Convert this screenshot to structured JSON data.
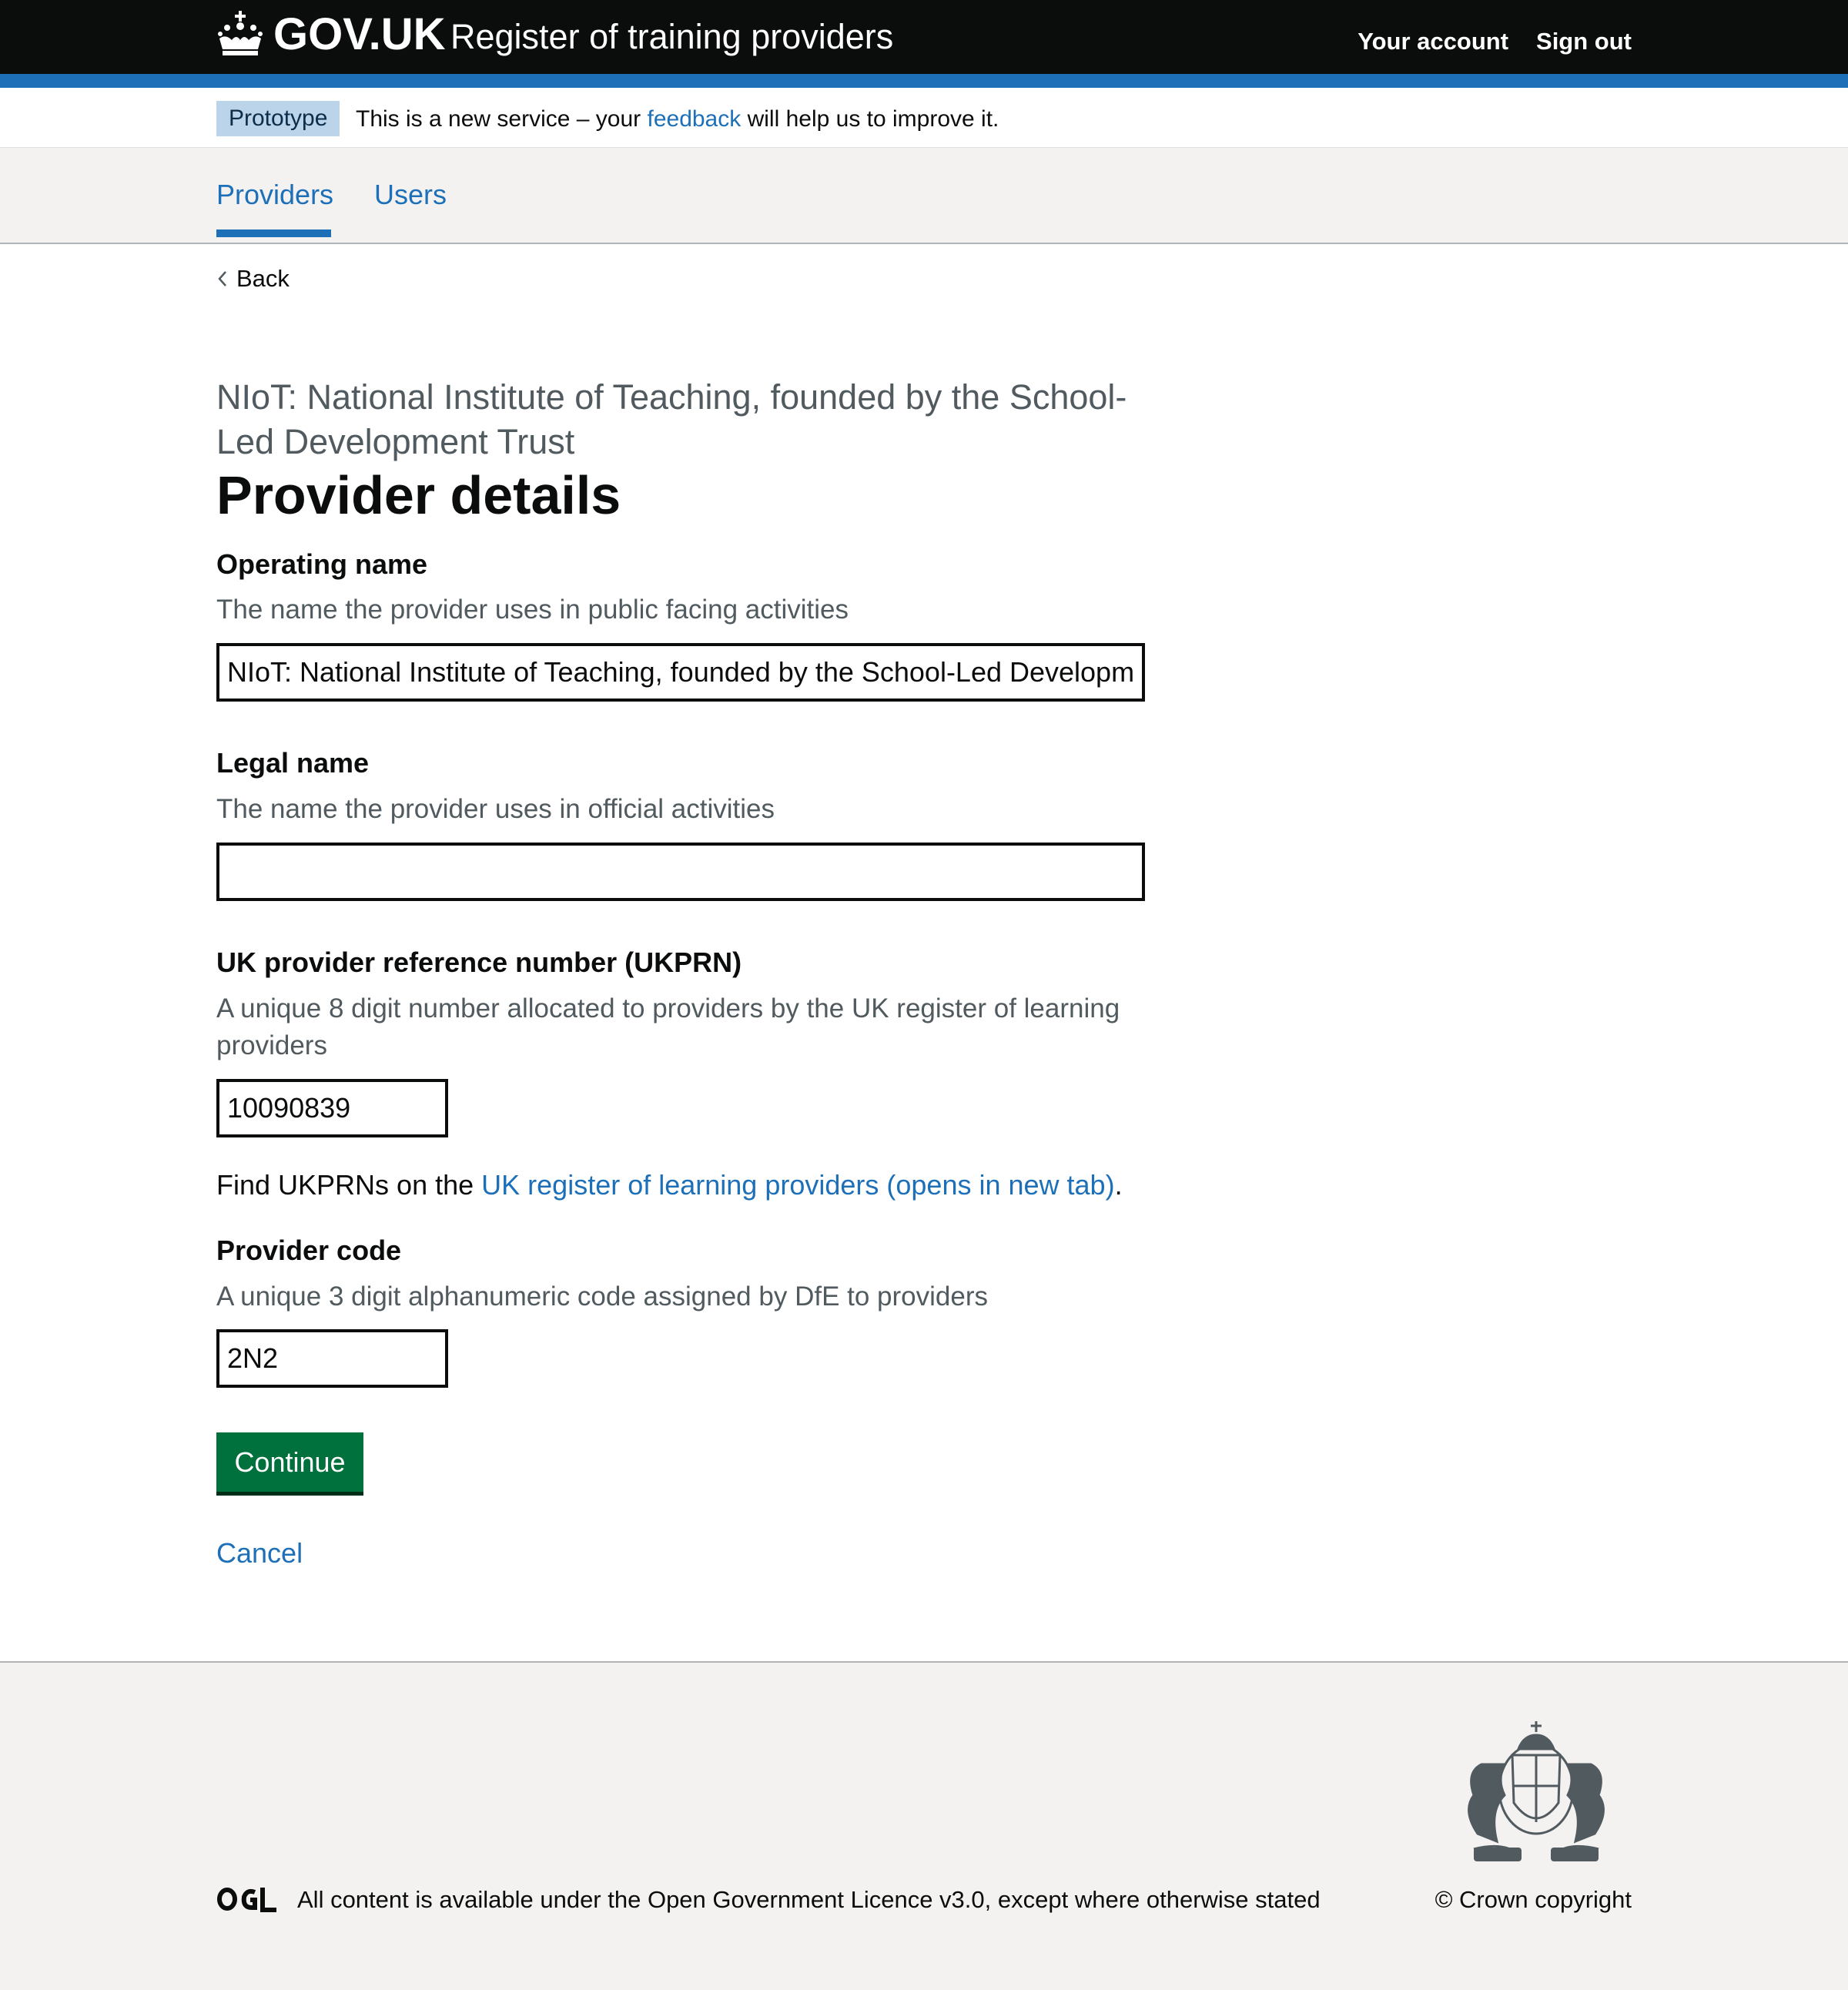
{
  "header": {
    "logo_text": "GOV.UK",
    "service_name": "Register of training providers",
    "links": [
      "Your account",
      "Sign out"
    ]
  },
  "phase_banner": {
    "tag": "Prototype",
    "text_before": "This is a new service – your ",
    "link": "feedback",
    "text_after": " will help us to improve it."
  },
  "nav": {
    "items": [
      "Providers",
      "Users"
    ],
    "active": "Providers"
  },
  "back_label": "Back",
  "main": {
    "caption": "NIoT: National Institute of Teaching, founded by the School-Led Development Trust",
    "title": "Provider details",
    "operating_name": {
      "label": "Operating name",
      "hint": "The name the provider uses in public facing activities",
      "value": "NIoT: National Institute of Teaching, founded by the School-Led Development Trust"
    },
    "legal_name": {
      "label": "Legal name",
      "hint": "The name the provider uses in official activities",
      "value": ""
    },
    "ukprn": {
      "label": "UK provider reference number (UKPRN)",
      "hint": "A unique 8 digit number allocated to providers by the UK register of learning providers",
      "value": "10090839"
    },
    "find": {
      "text_before": "Find UKPRNs on the ",
      "link": "UK register of learning providers (opens in new tab)",
      "text_after": "."
    },
    "provider_code": {
      "label": "Provider code",
      "hint": "A unique 3 digit alphanumeric code assigned by DfE to providers",
      "value": "2N2"
    },
    "continue_label": "Continue",
    "cancel_label": "Cancel"
  },
  "footer": {
    "licence_before": "All content is available under the ",
    "licence_link": "Open Government Licence v3.0",
    "licence_after": ", except where otherwise stated",
    "copyright": "© Crown copyright"
  },
  "colors": {
    "header": "#0b0c0c",
    "brand_blue": "#1d70b8",
    "button_green": "#00703c",
    "footer_bg": "#f3f2f1"
  }
}
